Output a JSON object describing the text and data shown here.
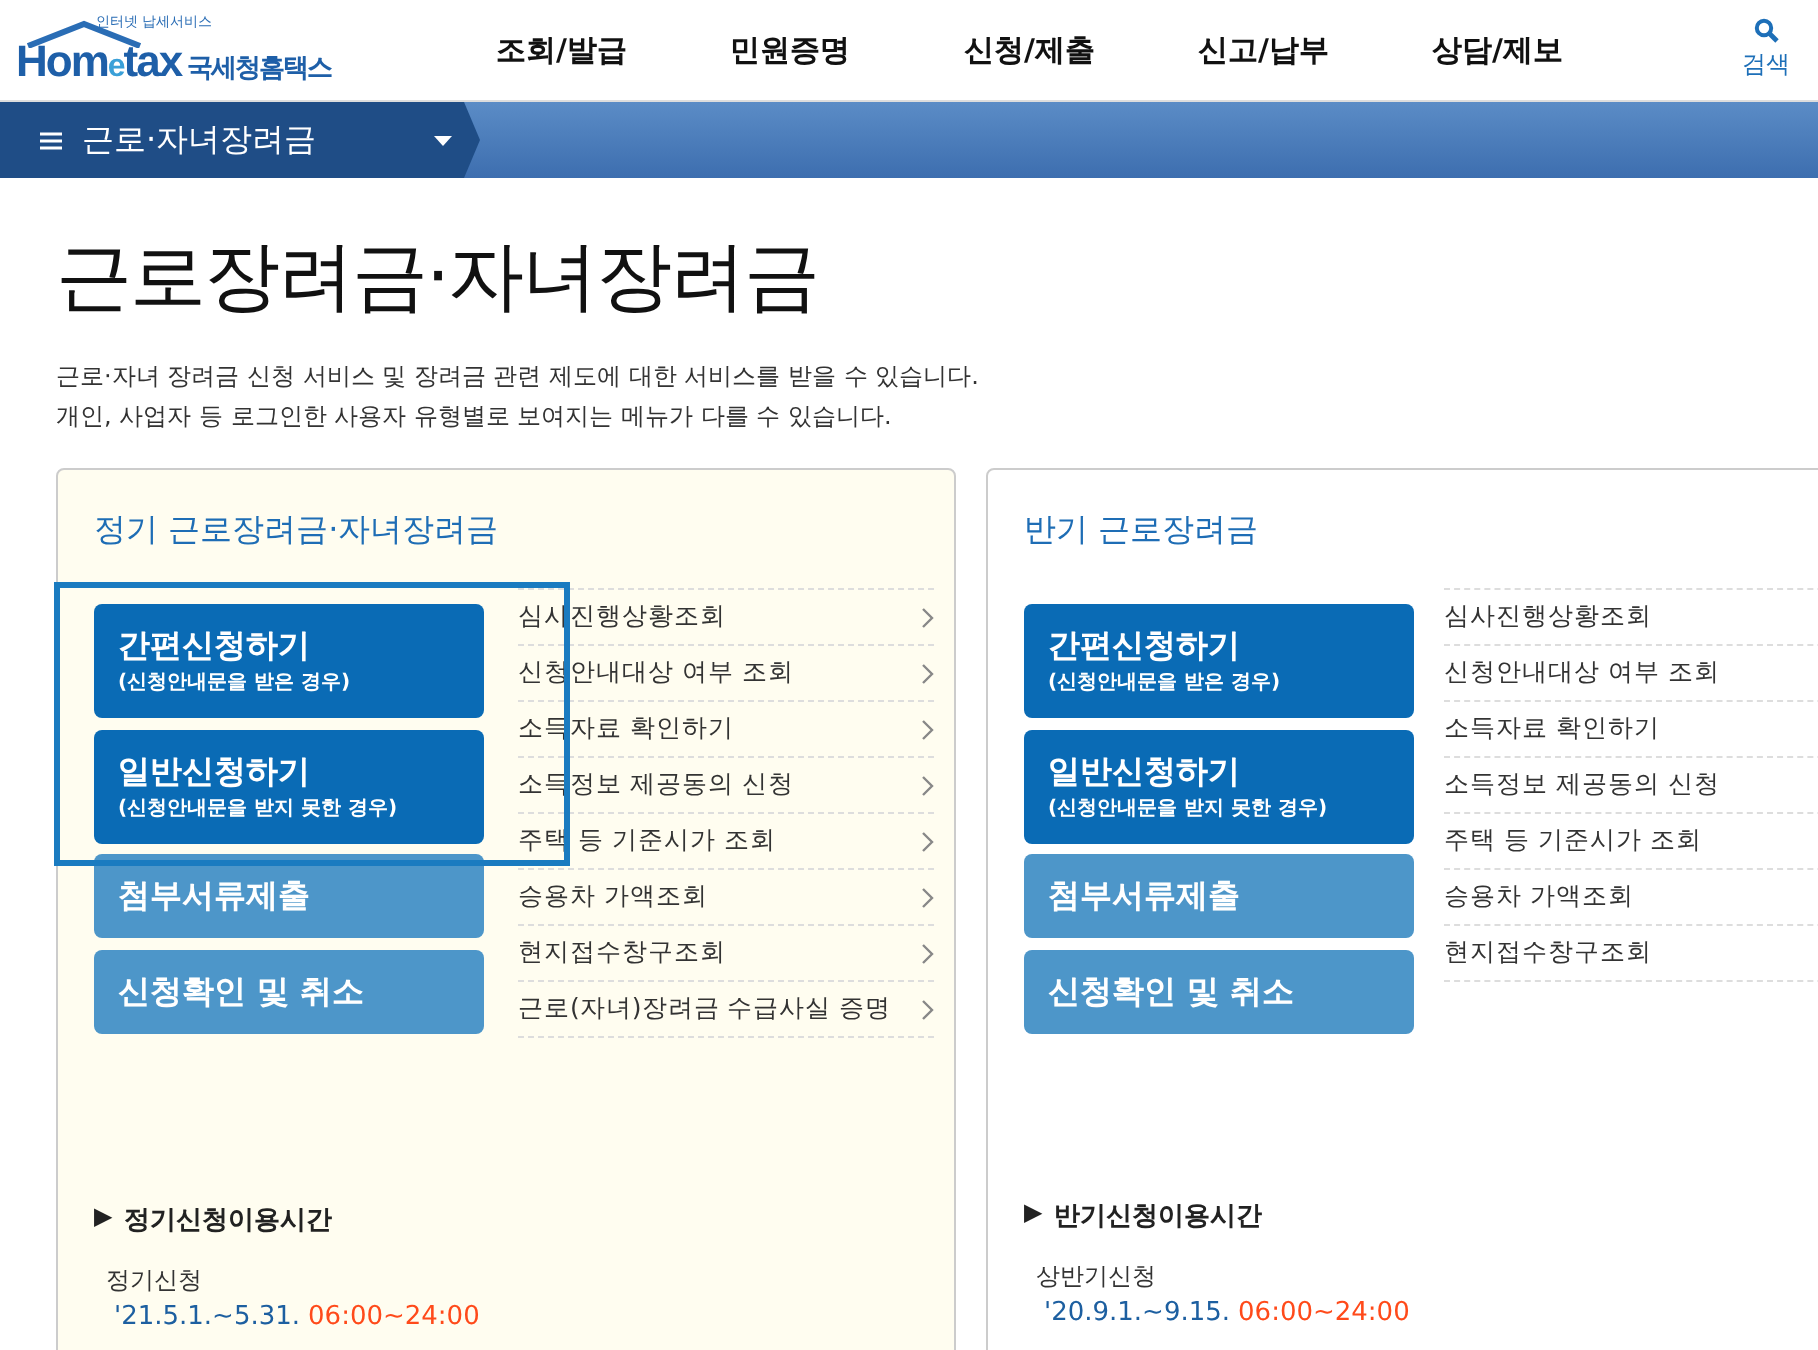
{
  "header": {
    "logo": {
      "tagline": "인터넷 납세서비스",
      "brand_a": "Hom",
      "brand_e": "e",
      "brand_b": "tax",
      "brand_kr": "국세청홈택스"
    },
    "nav": [
      "조회/발급",
      "민원증명",
      "신청/제출",
      "신고/납부",
      "상담/제보"
    ],
    "search_label": "검색"
  },
  "breadcrumb": {
    "label": "근로·자녀장려금"
  },
  "page": {
    "title": "근로장려금·자녀장려금",
    "description": [
      "근로·자녀 장려금 신청 서비스 및 장려금 관련 제도에 대한 서비스를 받을 수 있습니다.",
      "개인, 사업자 등 로그인한 사용자 유형별로 보여지는 메뉴가 다를 수 있습니다."
    ]
  },
  "panels": [
    {
      "title": "정기 근로장려금·자녀장려금",
      "tinted": true,
      "chevrons": true,
      "highlight_frame": true,
      "buttons": [
        {
          "kind": "primary",
          "label": "간편신청하기",
          "sub": "(신청안내문을 받은 경우)"
        },
        {
          "kind": "primary",
          "label": "일반신청하기",
          "sub": "(신청안내문을 받지 못한 경우)"
        },
        {
          "kind": "secondary",
          "label": "첨부서류제출"
        },
        {
          "kind": "secondary",
          "label": "신청확인 및 취소"
        }
      ],
      "links": [
        "심사진행상황조회",
        "신청안내대상 여부 조회",
        "소득자료 확인하기",
        "소득정보 제공동의 신청",
        "주택 등 기준시가 조회",
        "승용차 가액조회",
        "현지접수창구조회",
        "근로(자녀)장려금 수급사실 증명"
      ],
      "schedule": {
        "heading": "정기신청이용시간",
        "marker": "▶",
        "items": [
          {
            "label": "정기신청",
            "date": "'21.5.1.~5.31.",
            "time": "06:00~24:00"
          }
        ]
      }
    },
    {
      "title": "반기 근로장려금",
      "tinted": false,
      "chevrons": false,
      "highlight_frame": false,
      "buttons": [
        {
          "kind": "primary",
          "label": "간편신청하기",
          "sub": "(신청안내문을 받은 경우)"
        },
        {
          "kind": "primary",
          "label": "일반신청하기",
          "sub": "(신청안내문을 받지 못한 경우)"
        },
        {
          "kind": "secondary",
          "label": "첨부서류제출"
        },
        {
          "kind": "secondary",
          "label": "신청확인 및 취소"
        }
      ],
      "links": [
        "심사진행상황조회",
        "신청안내대상 여부 조회",
        "소득자료 확인하기",
        "소득정보 제공동의 신청",
        "주택 등 기준시가 조회",
        "승용차 가액조회",
        "현지접수창구조회"
      ],
      "schedule": {
        "heading": "반기신청이용시간",
        "marker": "▶",
        "items": [
          {
            "label": "상반기신청",
            "date": "'20.9.1.~9.15.",
            "time": "06:00~24:00"
          }
        ]
      }
    }
  ]
}
